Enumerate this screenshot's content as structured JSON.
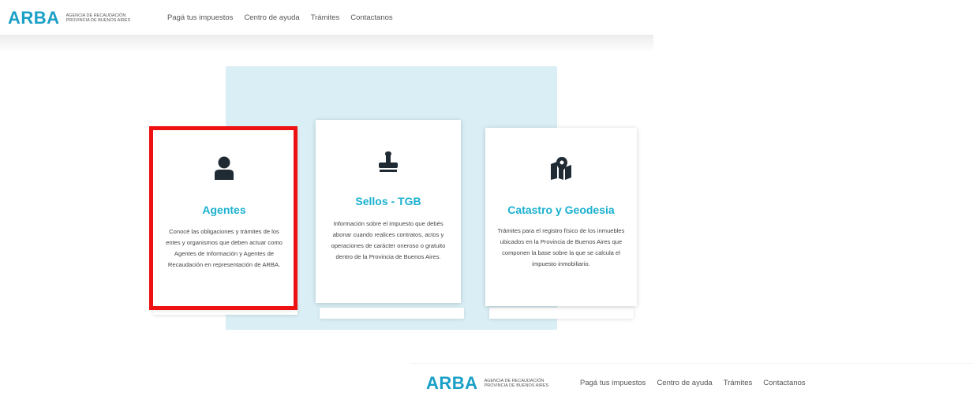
{
  "header": {
    "logo_text": "ARBA",
    "logo_sub_line1": "AGENCIA DE RECAUDACIÓN",
    "logo_sub_line2": "PROVINCIA DE BUENOS AIRES",
    "nav": [
      "Pagá tus impuestos",
      "Centro de ayuda",
      "Trámites",
      "Contactanos"
    ]
  },
  "cards": [
    {
      "icon": "user-icon",
      "title": "Agentes",
      "desc": "Conocé las obligaciones y trámites de los entes y organismos que deben actuar como Agentes de Información y Agentes de Recaudación en representación de ARBA."
    },
    {
      "icon": "stamp-icon",
      "title": "Sellos - TGB",
      "desc": "Información sobre el impuesto que debés abonar cuando realices contratos, actos y operaciones de carácter oneroso o gratuito dentro de la Provincia de Buenos Aires."
    },
    {
      "icon": "map-pin-icon",
      "title": "Catastro y Geodesia",
      "desc": "Trámites para el registro físico de los inmuebles ubicados en la Provincia de Buenos Aires que componen la base sobre la que se calcula el impuesto inmobiliario."
    }
  ],
  "colors": {
    "brand": "#1a9fc6",
    "title": "#1ab0cf",
    "highlight": "#ee1111",
    "panel": "#d9eff5"
  }
}
